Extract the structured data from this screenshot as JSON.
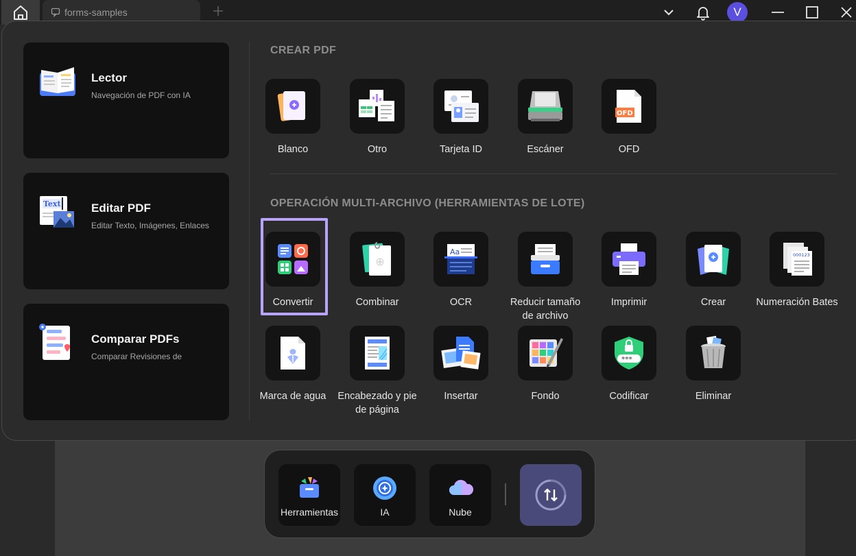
{
  "titlebar": {
    "tab_label": "forms-samples",
    "avatar_letter": "V"
  },
  "cards": [
    {
      "title": "Lector",
      "subtitle": "Navegación de PDF con IA",
      "icon": "book-icon"
    },
    {
      "title": "Editar PDF",
      "subtitle": "Editar Texto, Imágenes, Enlaces",
      "icon": "edit-text-icon",
      "icon_text": "Text"
    },
    {
      "title": "Comparar PDFs",
      "subtitle": "Comparar Revisiones de",
      "icon": "compare-icon"
    }
  ],
  "crear": {
    "title": "CREAR PDF",
    "items": [
      {
        "label": "Blanco",
        "icon": "blank-page-icon"
      },
      {
        "label": "Otro",
        "icon": "other-files-icon"
      },
      {
        "label": "Tarjeta ID",
        "icon": "id-card-icon"
      },
      {
        "label": "Escáner",
        "icon": "scanner-icon"
      },
      {
        "label": "OFD",
        "icon": "ofd-icon",
        "icon_text": "OFD"
      }
    ]
  },
  "batch": {
    "title": "OPERACIÓN MULTI-ARCHIVO (HERRAMIENTAS DE LOTE)",
    "items": [
      {
        "label": "Convertir",
        "icon": "convert-icon",
        "selected": true
      },
      {
        "label": "Combinar",
        "icon": "combine-icon"
      },
      {
        "label": "OCR",
        "icon": "ocr-icon",
        "icon_text": "Aa"
      },
      {
        "label": "Reducir tamaño de archivo",
        "icon": "compress-icon"
      },
      {
        "label": "Imprimir",
        "icon": "printer-icon"
      },
      {
        "label": "Crear",
        "icon": "create-icon"
      },
      {
        "label": "Numeración Bates",
        "icon": "bates-icon",
        "icon_text": "000123"
      },
      {
        "label": "Marca de agua",
        "icon": "watermark-icon"
      },
      {
        "label": "Encabezado y pie de página",
        "icon": "header-footer-icon"
      },
      {
        "label": "Insertar",
        "icon": "insert-icon"
      },
      {
        "label": "Fondo",
        "icon": "background-icon"
      },
      {
        "label": "Codificar",
        "icon": "encrypt-icon",
        "icon_text": "***"
      },
      {
        "label": "Eliminar",
        "icon": "trash-icon"
      }
    ]
  },
  "dock": {
    "items": [
      {
        "label": "Herramientas",
        "icon": "toolbox-icon"
      },
      {
        "label": "IA",
        "icon": "ai-icon"
      },
      {
        "label": "Nube",
        "icon": "cloud-icon"
      }
    ],
    "active_icon": "sync-icon"
  },
  "colors": {
    "accent": "#5b4fe0",
    "selection": "#b8a4ff",
    "panel": "#2b2b2b",
    "card": "#111111"
  }
}
